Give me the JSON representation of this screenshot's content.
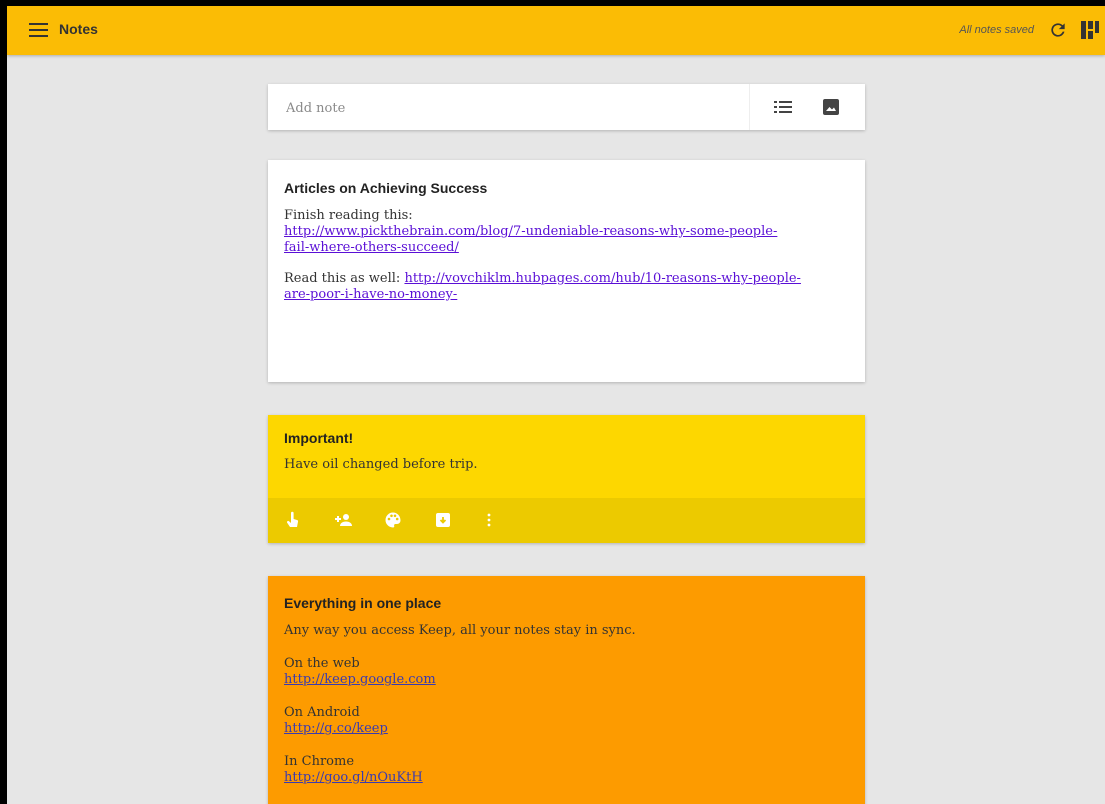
{
  "topbar": {
    "title": "Notes",
    "save_status": "All notes saved",
    "accent_color": "#fbbc05",
    "icons": [
      "menu-icon",
      "refresh-icon",
      "grid-view-icon"
    ]
  },
  "add_note": {
    "placeholder": "Add note",
    "icons": [
      "list-icon",
      "image-icon"
    ]
  },
  "notes": [
    {
      "title": "Articles on Achieving Success",
      "color": "#ffffff",
      "lines": {
        "p1_text": "Finish reading this:",
        "p1_link": "http://www.pickthebrain.com/blog/7-undeniable-reasons-why-some-people-fail-where-others-succeed/",
        "p1_link_line1": "http://www.pickthebrain.com/blog/7-undeniable-reasons-why-some-people-",
        "p1_link_line2": "fail-where-others-succeed/",
        "p2_text": "Read this as well: ",
        "p2_link_line1": "http://vovchiklm.hubpages.com/hub/10-reasons-why-people-",
        "p2_link_line2": "are-poor-i-have-no-money-"
      }
    },
    {
      "title": "Important!",
      "color": "#fdd700",
      "body": "Have oil changed before trip.",
      "toolbar_icons": [
        "reminder-hand-icon",
        "collaborator-icon",
        "palette-icon",
        "archive-icon",
        "more-vert-icon"
      ]
    },
    {
      "title": "Everything in one place",
      "color": "#fd9b00",
      "intro": "Any way you access Keep, all your notes stay in sync.",
      "web_label": "On the web",
      "web_link": "http://keep.google.com",
      "android_label": "On Android",
      "android_link": "http://g.co/keep",
      "chrome_label": "In Chrome",
      "chrome_link": "http://goo.gl/nOuKtH"
    }
  ]
}
